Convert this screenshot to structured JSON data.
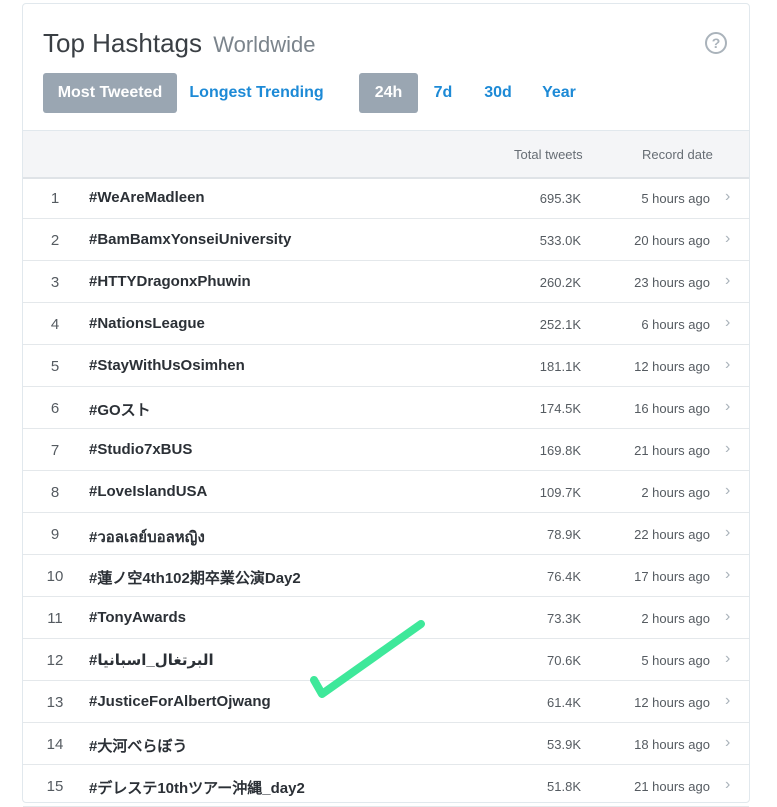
{
  "header": {
    "title": "Top Hashtags",
    "subtitle": "Worldwide",
    "help_icon": "question-circle-icon"
  },
  "tabs": {
    "most_tweeted": "Most Tweeted",
    "longest_trending": "Longest Trending",
    "selected_tab": "Most Tweeted"
  },
  "ranges": {
    "r24h": "24h",
    "r7d": "7d",
    "r30d": "30d",
    "year": "Year",
    "selected_range": "24h"
  },
  "table": {
    "col_total": "Total tweets",
    "col_date": "Record date",
    "rows": [
      {
        "rank": "1",
        "tag": "#WeAreMadleen",
        "tweets": "695.3K",
        "date": "5 hours ago"
      },
      {
        "rank": "2",
        "tag": "#BamBamxYonseiUniversity",
        "tweets": "533.0K",
        "date": "20 hours ago"
      },
      {
        "rank": "3",
        "tag": "#HTTYDragonxPhuwin",
        "tweets": "260.2K",
        "date": "23 hours ago"
      },
      {
        "rank": "4",
        "tag": "#NationsLeague",
        "tweets": "252.1K",
        "date": "6 hours ago"
      },
      {
        "rank": "5",
        "tag": "#StayWithUsOsimhen",
        "tweets": "181.1K",
        "date": "12 hours ago"
      },
      {
        "rank": "6",
        "tag": "#GOスト",
        "tweets": "174.5K",
        "date": "16 hours ago"
      },
      {
        "rank": "7",
        "tag": "#Studio7xBUS",
        "tweets": "169.8K",
        "date": "21 hours ago"
      },
      {
        "rank": "8",
        "tag": "#LoveIslandUSA",
        "tweets": "109.7K",
        "date": "2 hours ago"
      },
      {
        "rank": "9",
        "tag": "#วอลเลย์บอลหญิง",
        "tweets": "78.9K",
        "date": "22 hours ago"
      },
      {
        "rank": "10",
        "tag": "#蓮ノ空4th102期卒業公演Day2",
        "tweets": "76.4K",
        "date": "17 hours ago"
      },
      {
        "rank": "11",
        "tag": "#TonyAwards",
        "tweets": "73.3K",
        "date": "2 hours ago"
      },
      {
        "rank": "12",
        "tag": "#البرتغال_اسبانيا",
        "tweets": "70.6K",
        "date": "5 hours ago"
      },
      {
        "rank": "13",
        "tag": "#JusticeForAlbertOjwang",
        "tweets": "61.4K",
        "date": "12 hours ago"
      },
      {
        "rank": "14",
        "tag": "#大河べらぼう",
        "tweets": "53.9K",
        "date": "18 hours ago"
      },
      {
        "rank": "15",
        "tag": "#デレステ10thツアー沖縄_day2",
        "tweets": "51.8K",
        "date": "21 hours ago"
      }
    ]
  },
  "annotation": {
    "icon": "green-checkmark-icon",
    "color": "#3ee89a",
    "marks_row": "13"
  },
  "colors": {
    "link": "#1d8ad6",
    "active_tab_bg": "#9aa6b2"
  }
}
